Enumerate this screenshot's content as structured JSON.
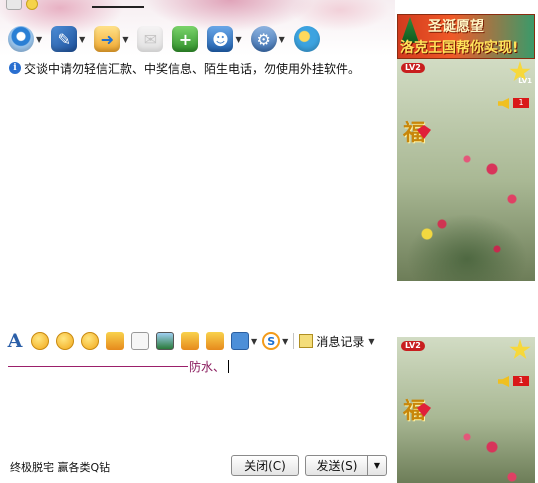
{
  "toolbar": {
    "items": [
      {
        "name": "video",
        "icon": "webcam-icon",
        "has_menu": true
      },
      {
        "name": "voice",
        "icon": "microphone-icon",
        "has_menu": true
      },
      {
        "name": "files",
        "icon": "folder-icon",
        "has_menu": true
      },
      {
        "name": "mail",
        "icon": "mail-icon",
        "has_menu": false
      },
      {
        "name": "add",
        "icon": "add-icon",
        "has_menu": false
      },
      {
        "name": "contacts",
        "icon": "user-icon",
        "has_menu": true
      },
      {
        "name": "settings",
        "icon": "settings-icon",
        "has_menu": true
      },
      {
        "name": "apps",
        "icon": "app-icon",
        "has_menu": false
      }
    ]
  },
  "notice": {
    "icon": "info-icon",
    "text": "交谈中请勿轻信汇款、中奖信息、陌生电话，勿使用外挂软件。"
  },
  "format_bar": {
    "font_label": "A",
    "history_label": "消息记录"
  },
  "input": {
    "text": "防水、"
  },
  "footer": {
    "status_text": "终极脱宅 赢各类Q钻",
    "close_label": "关闭(C)",
    "send_label": "发送(S)"
  },
  "sidebar": {
    "ad": {
      "line1": "圣诞愿望",
      "line2": "洛克王国帮你实现!"
    },
    "show_panels": [
      {
        "level_badge": "LV2",
        "star_level": "LV1",
        "count": "1",
        "fu_char": "福"
      },
      {
        "level_badge": "LV2",
        "count": "1",
        "fu_char": "福"
      }
    ]
  },
  "colors": {
    "accent": "#2b5fa8",
    "input_ink": "#8a1c5e",
    "notice_icon": "#2a6fd0"
  }
}
